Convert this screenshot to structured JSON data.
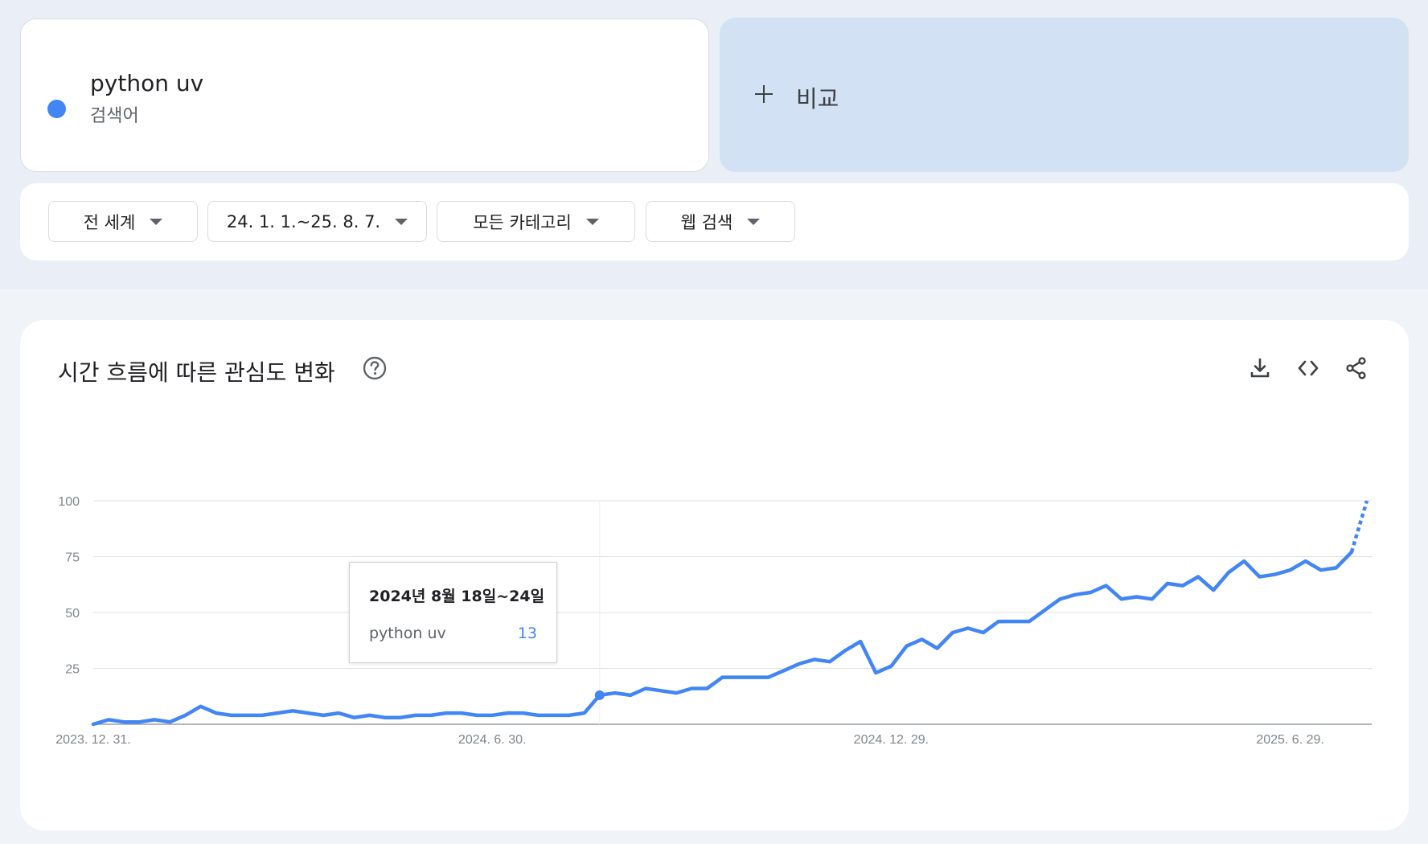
{
  "colors": {
    "series": "#4285f4",
    "grid": "#e0e0e0",
    "axis": "#9aa0a6",
    "tick_text": "#80868b"
  },
  "term": {
    "name": "python uv",
    "type": "검색어"
  },
  "compare": {
    "label": "비교"
  },
  "filters": [
    {
      "label": "전 세계"
    },
    {
      "label": "24. 1. 1.~25. 8. 7."
    },
    {
      "label": "모든 카테고리"
    },
    {
      "label": "웹 검색"
    }
  ],
  "chart_header": {
    "title": "시간 흐름에 따른 관심도 변화",
    "icons": [
      "help-icon",
      "download-icon",
      "embed-code-icon",
      "share-icon"
    ]
  },
  "tooltip": {
    "date": "2024년 8월 18일~24일",
    "series": "python uv",
    "value": "13"
  },
  "chart_data": {
    "type": "line",
    "ylim": [
      0,
      100
    ],
    "yticks": [
      "100",
      "75",
      "50",
      "25"
    ],
    "xticks": [
      "2023. 12. 31.",
      "2024. 6. 30.",
      "2024. 12. 29.",
      "2025. 6. 29."
    ],
    "series": [
      {
        "name": "python uv",
        "values": [
          0,
          2,
          1,
          1,
          2,
          1,
          4,
          8,
          5,
          4,
          4,
          4,
          5,
          6,
          5,
          4,
          5,
          3,
          4,
          3,
          3,
          4,
          4,
          5,
          5,
          4,
          4,
          5,
          5,
          4,
          4,
          4,
          5,
          13,
          14,
          13,
          16,
          15,
          14,
          16,
          16,
          21,
          21,
          21,
          21,
          24,
          27,
          29,
          28,
          33,
          37,
          23,
          26,
          35,
          38,
          34,
          41,
          43,
          41,
          46,
          46,
          46,
          51,
          56,
          58,
          59,
          62,
          56,
          57,
          56,
          63,
          62,
          66,
          60,
          68,
          73,
          66,
          67,
          69,
          73,
          69,
          70,
          77,
          100
        ],
        "partial_last": true
      }
    ],
    "highlight_index": 33
  }
}
